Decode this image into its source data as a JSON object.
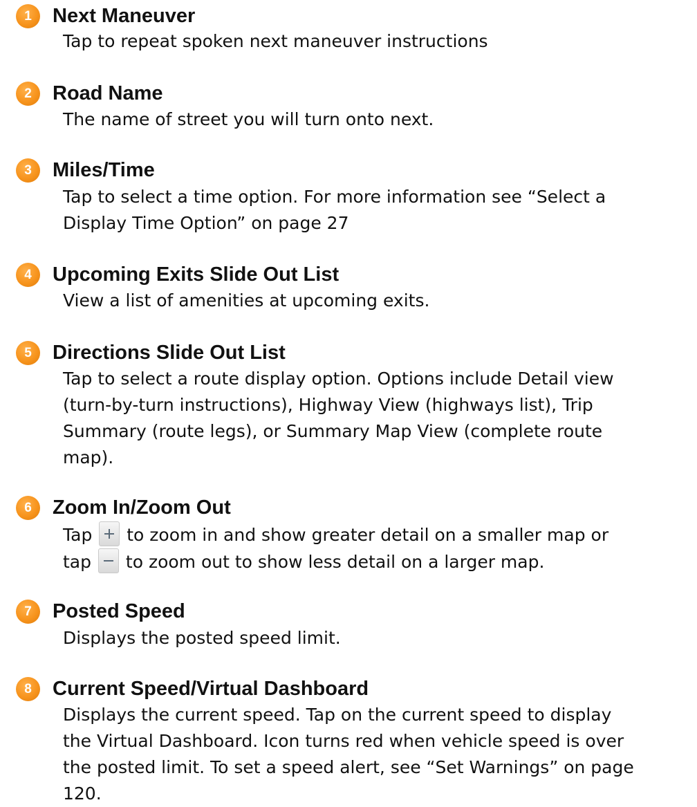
{
  "items": [
    {
      "number": "1",
      "title": "Next Maneuver",
      "lines": [
        "Tap to repeat spoken next maneuver instructions"
      ]
    },
    {
      "number": "2",
      "title": "Road Name",
      "lines": [
        "The name of street you will turn onto next."
      ]
    },
    {
      "number": "3",
      "title": "Miles/Time",
      "lines": [
        "Tap to select a time option. For more information see “Select a",
        "Display Time Option” on page 27"
      ]
    },
    {
      "number": "4",
      "title": "Upcoming Exits Slide Out List",
      "lines": [
        "View a list of amenities at upcoming exits."
      ]
    },
    {
      "number": "5",
      "title": "Directions Slide Out List",
      "lines": [
        "Tap to select a route display option. Options include Detail view",
        "(turn-by-turn instructions), Highway View (highways list),  Trip",
        "Summary (route legs), or Summary Map View (complete route",
        "map)."
      ]
    },
    {
      "number": "6",
      "title": "Zoom In/Zoom Out",
      "line1_pre": "Tap",
      "line1_post": "to zoom in and show greater detail on a smaller map or",
      "line2_pre": "tap",
      "line2_post": "to zoom out to show less detail on a larger map.",
      "zoom_in_icon": "plus-icon",
      "zoom_out_icon": "minus-icon"
    },
    {
      "number": "7",
      "title": "Posted Speed",
      "lines": [
        "Displays the posted speed limit."
      ]
    },
    {
      "number": "8",
      "title": "Current Speed/Virtual Dashboard",
      "lines": [
        "Displays the current speed. Tap on the current speed to display",
        "the Virtual Dashboard.  Icon turns red when vehicle speed is over",
        "the posted limit. To set a speed alert, see “Set Warnings” on page",
        "120."
      ]
    }
  ],
  "colors": {
    "badge": "#f7941d",
    "text": "#111111"
  }
}
